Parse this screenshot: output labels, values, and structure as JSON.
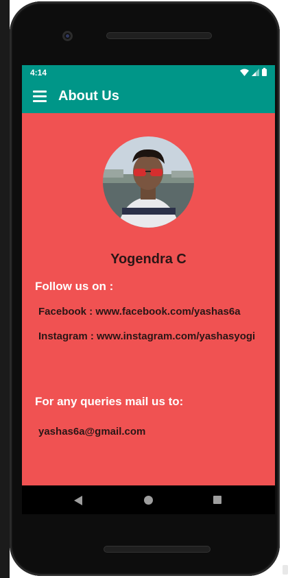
{
  "status_bar": {
    "time": "4:14",
    "icons": [
      "wifi-icon",
      "signal-icon",
      "battery-icon"
    ]
  },
  "app_bar": {
    "title": "About Us",
    "menu_icon": "hamburger-menu-icon"
  },
  "profile": {
    "name": "Yogendra C"
  },
  "follow": {
    "heading": "Follow us on :",
    "facebook": "Facebook : www.facebook.com/yashas6a",
    "instagram": "Instagram : www.instagram.com/yashasyogi"
  },
  "contact": {
    "heading": "For any queries mail us to:",
    "email": "yashas6a@gmail.com"
  },
  "nav_bar": {
    "icons": [
      "back-icon",
      "home-icon",
      "recents-icon"
    ]
  },
  "colors": {
    "primary": "#009688",
    "background": "#f05252",
    "text_dark": "#2a1616",
    "text_light": "#ffffff"
  }
}
